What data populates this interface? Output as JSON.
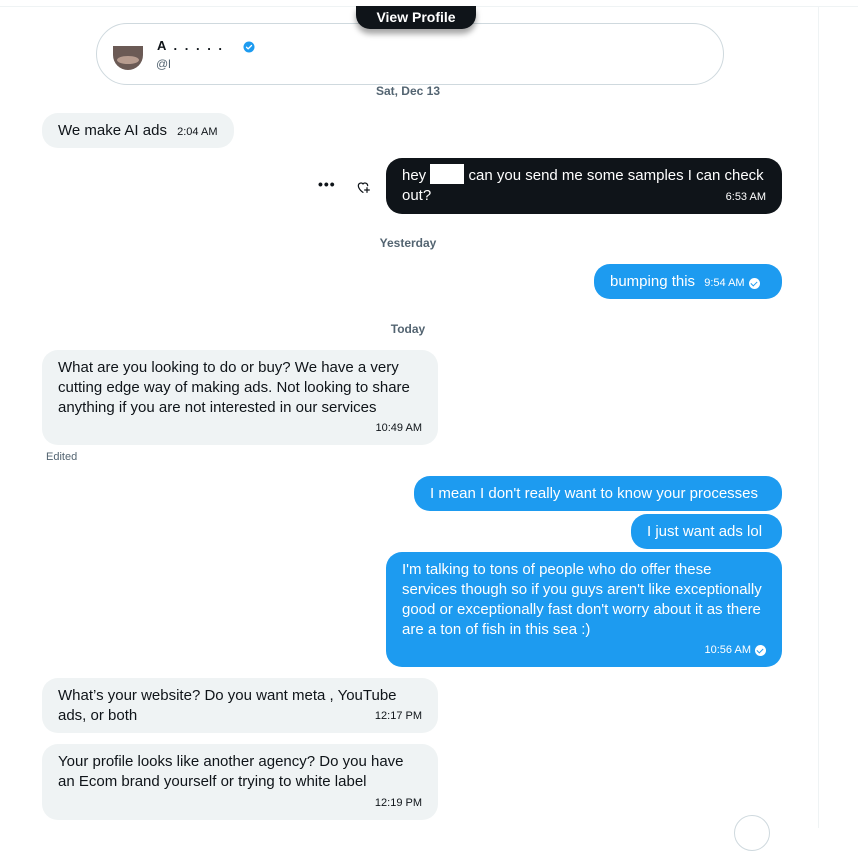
{
  "header": {
    "view_profile_label": "View Profile",
    "name": "A . . . . .",
    "handle": "@l"
  },
  "dates": {
    "first": "Sat, Dec 13",
    "second": "Yesterday",
    "third": "Today"
  },
  "messages": [
    {
      "from": "them",
      "text": "We make AI ads",
      "time": "2:04 AM"
    },
    {
      "from": "me",
      "text_before": "hey",
      "text_after": "can you send me some samples I can check out?",
      "time": "6:53 AM"
    },
    {
      "from": "me",
      "text": "bumping this",
      "time": "9:54 AM"
    },
    {
      "from": "them",
      "text": "What are you looking to do or buy? We have a very cutting edge way of making ads. Not looking to share anything if you are not interested in our services",
      "time": "10:49 AM",
      "edited_label": "Edited"
    },
    {
      "from": "me",
      "text": "I mean I don't really want to know your processes"
    },
    {
      "from": "me",
      "text": "I just want ads lol"
    },
    {
      "from": "me",
      "text": "I'm talking to tons of people who do offer these services though so if you guys aren't like exceptionally good or exceptionally fast don't worry about it as there are a ton of fish in this sea :)",
      "time": "10:56 AM"
    },
    {
      "from": "them",
      "text": "What’s your website? Do you want meta , YouTube ads, or both",
      "time": "12:17 PM"
    },
    {
      "from": "them",
      "text": "Your profile looks like another agency? Do you have an Ecom brand yourself or trying to white label",
      "time": "12:19 PM"
    }
  ],
  "icons": {
    "more": "more-icon",
    "react": "heart-plus-icon",
    "verified": "verified-badge-icon",
    "read": "check-circle-icon"
  },
  "colors": {
    "accent": "#1d9bf0",
    "dark_bubble": "#0f1419",
    "incoming_bubble": "#eff3f4"
  }
}
